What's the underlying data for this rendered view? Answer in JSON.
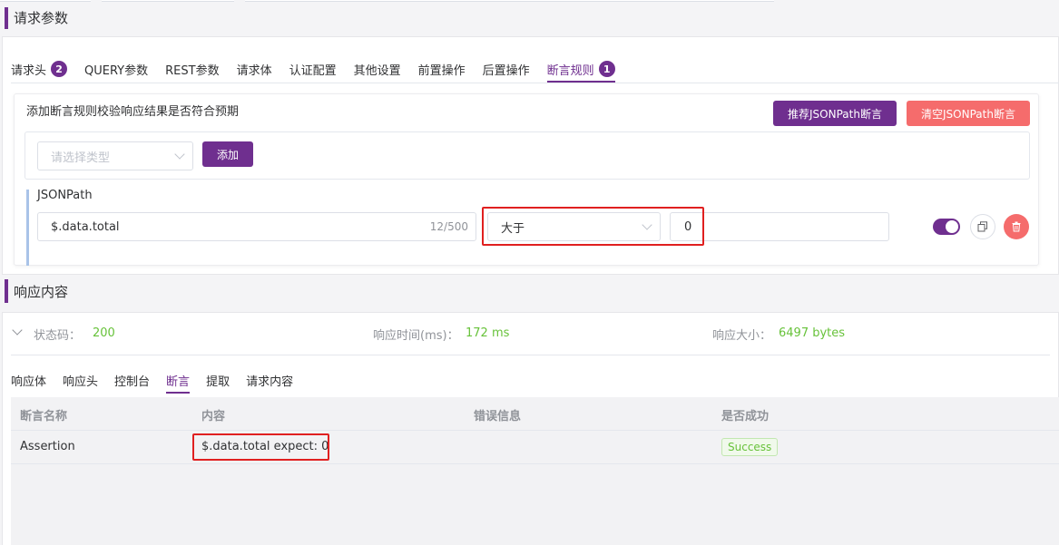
{
  "request_section": {
    "title": "请求参数",
    "tabs": [
      {
        "label": "请求头",
        "badge": "2",
        "active": false
      },
      {
        "label": "QUERY参数",
        "badge": "",
        "active": false
      },
      {
        "label": "REST参数",
        "badge": "",
        "active": false
      },
      {
        "label": "请求体",
        "badge": "",
        "active": false
      },
      {
        "label": "认证配置",
        "badge": "",
        "active": false
      },
      {
        "label": "其他设置",
        "badge": "",
        "active": false
      },
      {
        "label": "前置操作",
        "badge": "",
        "active": false
      },
      {
        "label": "后置操作",
        "badge": "",
        "active": false
      },
      {
        "label": "断言规则",
        "badge": "1",
        "active": true
      }
    ],
    "assertion_card": {
      "description": "添加断言规则校验响应结果是否符合预期",
      "recommend_button": "推荐JSONPath断言",
      "clear_button": "清空JSONPath断言",
      "type_select_placeholder": "请选择类型",
      "add_button": "添加",
      "rule": {
        "label": "JSONPath",
        "path_value": "$.data.total",
        "path_counter": "12/500",
        "operator": "大于",
        "expected_value": "0",
        "enabled": true
      }
    }
  },
  "response_section": {
    "title": "响应内容",
    "status_label": "状态码：",
    "status_value": "200",
    "time_label": "响应时间(ms)：",
    "time_value": "172 ms",
    "size_label": "响应大小：",
    "size_value": "6497 bytes",
    "tabs": [
      {
        "label": "响应体",
        "active": false
      },
      {
        "label": "响应头",
        "active": false
      },
      {
        "label": "控制台",
        "active": false
      },
      {
        "label": "断言",
        "active": true
      },
      {
        "label": "提取",
        "active": false
      },
      {
        "label": "请求内容",
        "active": false
      }
    ],
    "table": {
      "columns": [
        "断言名称",
        "内容",
        "错误信息",
        "是否成功"
      ],
      "rows": [
        {
          "name": "Assertion",
          "content": "$.data.total expect: 0",
          "error": "",
          "success": "Success"
        }
      ]
    }
  },
  "colors": {
    "accent": "#6f2f8f",
    "danger": "#f56c6c",
    "success": "#67c23a",
    "highlight_box": "#e02020"
  }
}
